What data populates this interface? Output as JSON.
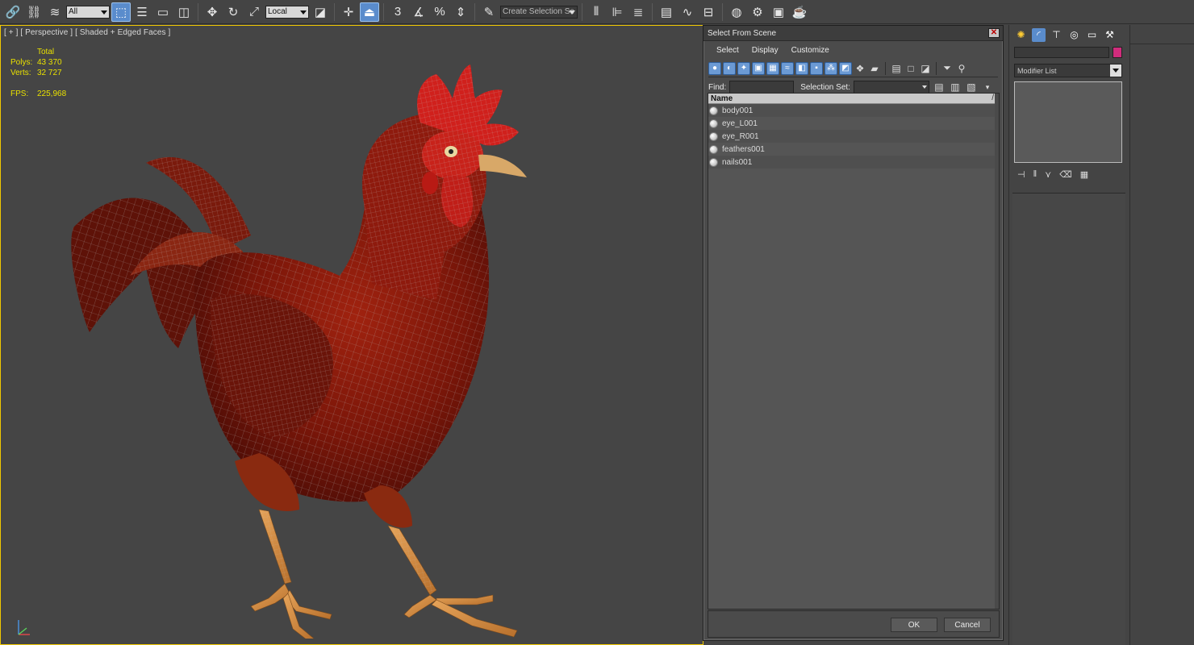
{
  "toolbar": {
    "filter_value": "All",
    "coord_system_value": "Local",
    "selection_set_placeholder": "Create Selection Se"
  },
  "viewport": {
    "label": "[ + ] [ Perspective ] [ Shaded + Edged Faces ]",
    "stats": {
      "total_label": "Total",
      "polys_label": "Polys:",
      "polys_value": "43 370",
      "verts_label": "Verts:",
      "verts_value": "32 727",
      "fps_label": "FPS:",
      "fps_value": "225,968"
    }
  },
  "dialog": {
    "title": "Select From Scene",
    "close_glyph": "✕",
    "menu": [
      "Select",
      "Display",
      "Customize"
    ],
    "find_label": "Find:",
    "find_value": "",
    "selection_set_label": "Selection Set:",
    "selection_set_value": "",
    "list_header": "Name",
    "list_sort_glyph": "/",
    "objects": [
      "body001",
      "eye_L001",
      "eye_R001",
      "feathers001",
      "nails001"
    ],
    "ok_label": "OK",
    "cancel_label": "Cancel"
  },
  "command_panel": {
    "object_name_value": "",
    "object_color": "#d02c7c",
    "modifier_list_label": "Modifier List"
  },
  "colors": {
    "viewport_border": "#f0c800",
    "stats_text": "#e8e000",
    "active_button": "#5a8ccc",
    "rooster_body": "#8a1810",
    "rooster_comb": "#d0201c",
    "rooster_legs": "#d89040"
  }
}
